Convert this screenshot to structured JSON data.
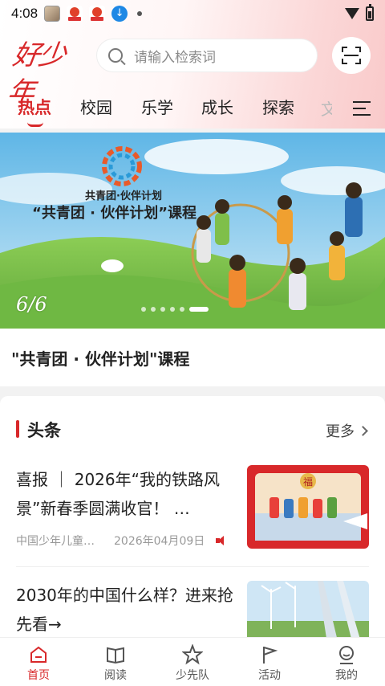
{
  "status_bar": {
    "time": "4:08"
  },
  "header": {
    "logo_text": "好少年",
    "search_placeholder": "请输入检索词"
  },
  "tabs": [
    {
      "label": "热点",
      "active": true
    },
    {
      "label": "校园"
    },
    {
      "label": "乐学"
    },
    {
      "label": "成长"
    },
    {
      "label": "探索"
    }
  ],
  "banner": {
    "logo_caption": "共青团·伙伴计划",
    "headline": "“共青团 · 伙伴计划”课程",
    "counter": "6/6",
    "caption": "\"共青团 · 伙伴计划\"课程",
    "total_slides": 6,
    "active_slide": 6
  },
  "section": {
    "title": "头条",
    "more_label": "更多"
  },
  "articles": [
    {
      "title": "喜报 ｜ 2026年“我的铁路风景”新春季圆满收官！ …",
      "source": "中国少年儿童…",
      "date": "2026年04月09日",
      "thumb_sign": "福"
    },
    {
      "title": "2030年的中国什么样？进来抢先看→"
    }
  ],
  "bottom_nav": [
    {
      "label": "首页",
      "icon": "home-icon",
      "active": true
    },
    {
      "label": "阅读",
      "icon": "book-icon"
    },
    {
      "label": "少先队",
      "icon": "star-icon"
    },
    {
      "label": "活动",
      "icon": "flag-icon"
    },
    {
      "label": "我的",
      "icon": "profile-icon"
    }
  ],
  "colors": {
    "accent": "#d8282a",
    "sky": "#8fd0f0",
    "grass": "#7cc24a"
  }
}
